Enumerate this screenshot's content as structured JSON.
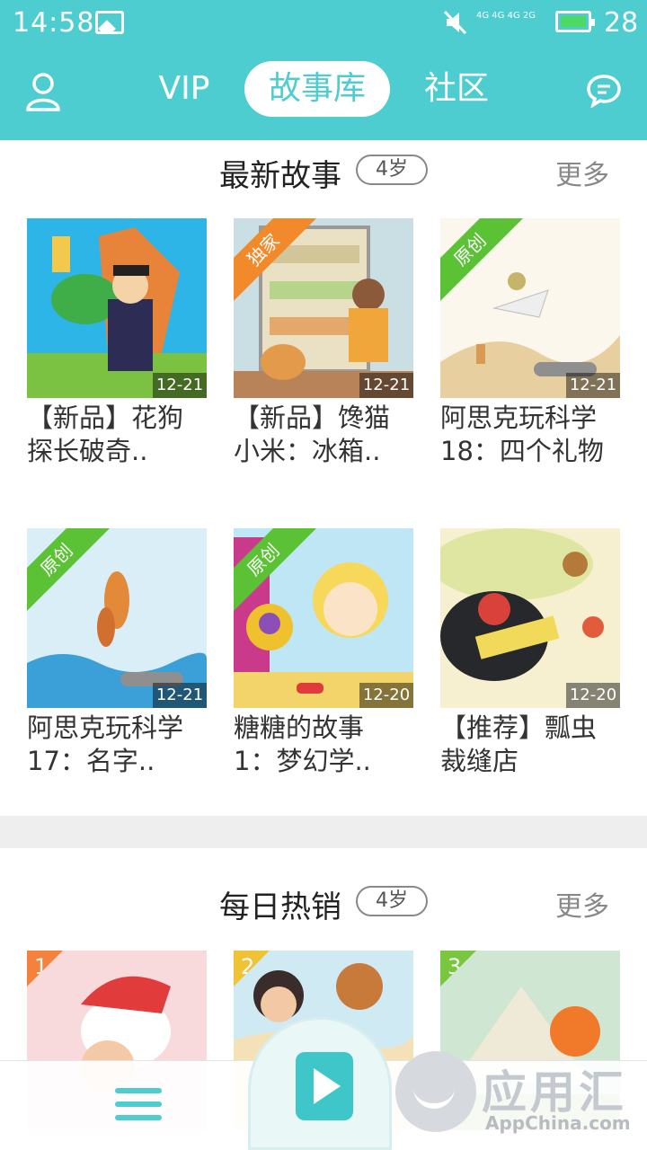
{
  "status_bar": {
    "time": "14:58",
    "network": "4G 4G 4G 2G",
    "battery_level": "28",
    "battery_color": "#4cd964"
  },
  "colors": {
    "brand": "#4ecdd0",
    "ribbon_green": "#5bc236",
    "ribbon_orange": "#f28a2c"
  },
  "nav": {
    "tabs": [
      {
        "label": "VIP"
      },
      {
        "label": "故事库",
        "active": true
      },
      {
        "label": "社区"
      }
    ],
    "left_icon": "user-icon",
    "right_icon": "message-icon"
  },
  "latest": {
    "title": "最新故事",
    "age": "4岁",
    "more": "更多",
    "cards": [
      {
        "title": "【新品】花狗\n探长破奇..",
        "date": "12-21",
        "badge": ""
      },
      {
        "title": "【新品】馋猫\n小米：冰箱..",
        "date": "12-21",
        "badge": "独家"
      },
      {
        "title": "阿思克玩科学\n18：四个礼物",
        "date": "12-21",
        "badge": "原创"
      },
      {
        "title": "阿思克玩科学\n17：名字..",
        "date": "12-21",
        "badge": "原创"
      },
      {
        "title": "糖糖的故事\n1：梦幻学..",
        "date": "12-20",
        "badge": "原创"
      },
      {
        "title": "【推荐】瓢虫\n裁缝店",
        "date": "12-20",
        "badge": ""
      }
    ]
  },
  "hot": {
    "title": "每日热销",
    "age": "4岁",
    "more": "更多",
    "ranks": [
      "1",
      "2",
      "3"
    ]
  },
  "bottom": {
    "menu_icon": "menu-icon",
    "play_icon": "play-icon",
    "watermark_cn": "应用汇",
    "watermark_en": "AppChina.com"
  }
}
